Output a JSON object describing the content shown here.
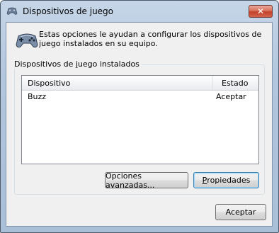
{
  "window": {
    "title": "Dispositivos de juego",
    "close_label": "✕"
  },
  "intro": {
    "text": "Estas opciones le ayudan a configurar los dispositivos de juego instalados en su equipo."
  },
  "group": {
    "label_prefix": "Dispositivos de ",
    "label_mnemonic": "j",
    "label_suffix": "uego instalados"
  },
  "list": {
    "columns": [
      "Dispositivo",
      "Estado"
    ],
    "rows": [
      {
        "device": "Buzz",
        "status": "Aceptar"
      }
    ]
  },
  "buttons": {
    "advanced": "Opciones avanzadas...",
    "properties_mnemonic": "P",
    "properties_rest": "ropiedades",
    "ok": "Aceptar"
  },
  "colors": {
    "title_bar": "#b3c7de",
    "client_bg": "#f0f0f0",
    "close_button": "#c2402a",
    "default_button_border": "#3c7fb1"
  }
}
